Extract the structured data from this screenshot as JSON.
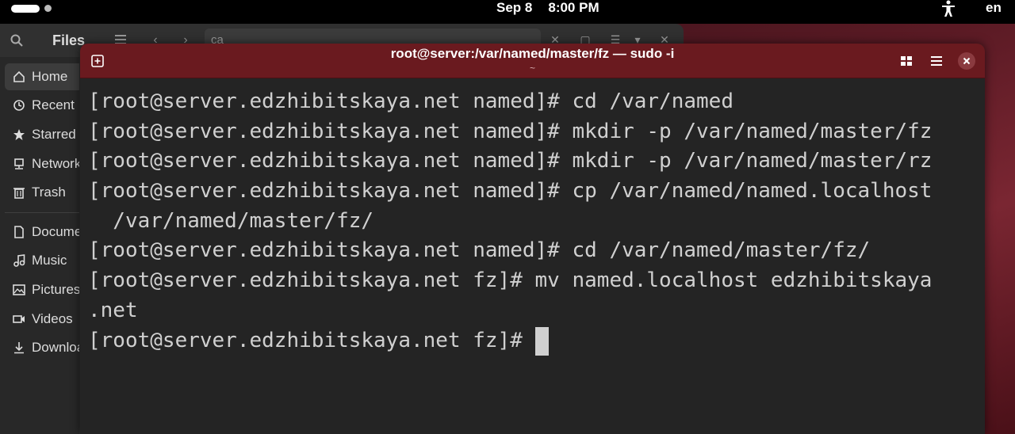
{
  "topbar": {
    "date": "Sep 8",
    "time": "8:00 PM",
    "language": "en",
    "icons": [
      "activities-pill",
      "workspace-dot",
      "accessibility-icon"
    ]
  },
  "files": {
    "title": "Files",
    "path_text": "ca",
    "sidebar": {
      "items": [
        {
          "label": "Home",
          "icon": "home-icon",
          "active": true
        },
        {
          "label": "Recent",
          "icon": "clock-icon"
        },
        {
          "label": "Starred",
          "icon": "star-icon"
        },
        {
          "label": "Network",
          "icon": "network-icon"
        },
        {
          "label": "Trash",
          "icon": "trash-icon"
        },
        {
          "label": "Documents",
          "icon": "document-icon"
        },
        {
          "label": "Music",
          "icon": "music-icon"
        },
        {
          "label": "Pictures",
          "icon": "picture-icon"
        },
        {
          "label": "Videos",
          "icon": "video-icon"
        },
        {
          "label": "Downloads",
          "icon": "download-icon"
        }
      ]
    }
  },
  "terminal": {
    "title": "root@server:/var/named/master/fz — sudo -i",
    "subtitle": "~",
    "header_color": "#6a1a1f",
    "lines": [
      "[root@server.edzhibitskaya.net named]# cd /var/named",
      "[root@server.edzhibitskaya.net named]# mkdir -p /var/named/master/fz",
      "[root@server.edzhibitskaya.net named]# mkdir -p /var/named/master/rz",
      "[root@server.edzhibitskaya.net named]# cp /var/named/named.localhost",
      "  /var/named/master/fz/",
      "[root@server.edzhibitskaya.net named]# cd /var/named/master/fz/",
      "[root@server.edzhibitskaya.net fz]# mv named.localhost edzhibitskaya",
      ".net",
      "[root@server.edzhibitskaya.net fz]# "
    ]
  }
}
